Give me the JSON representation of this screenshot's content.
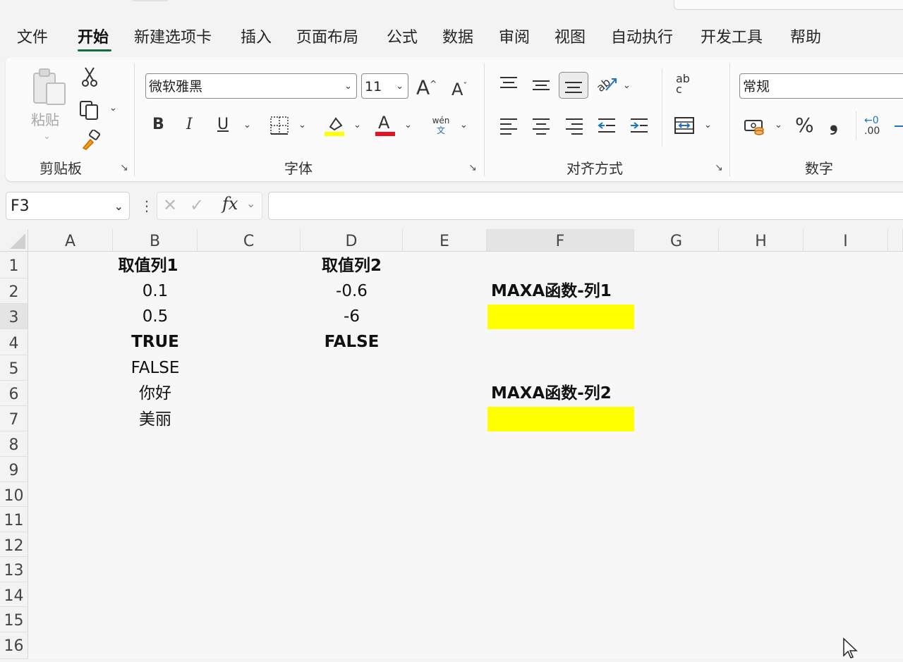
{
  "menu_tabs": [
    "文件",
    "开始",
    "新建选项卡",
    "插入",
    "页面布局",
    "公式",
    "数据",
    "审阅",
    "视图",
    "自动执行",
    "开发工具",
    "帮助"
  ],
  "active_tab": "开始",
  "ribbon": {
    "clipboard": {
      "paste_label": "粘贴",
      "group_label": "剪贴板"
    },
    "font": {
      "font_name": "微软雅黑",
      "font_size": "11",
      "bold": "B",
      "italic": "I",
      "underline": "U",
      "group_label": "字体",
      "phonetic_top": "wén",
      "phonetic_bottom": "文"
    },
    "alignment": {
      "group_label": "对齐方式",
      "wrap_ab": "ab",
      "wrap_c": "c"
    },
    "number": {
      "format": "常规",
      "group_label": "数字",
      "percent": "%",
      "comma": "❟",
      "dec_top": "←0",
      "dec_bottom": ".00"
    }
  },
  "formula_bar": {
    "name_box": "F3",
    "fx": "fx",
    "formula": ""
  },
  "columns": [
    "A",
    "B",
    "C",
    "D",
    "E",
    "F",
    "G",
    "H",
    "I"
  ],
  "rows": [
    "1",
    "2",
    "3",
    "4",
    "5",
    "6",
    "7",
    "8",
    "9",
    "10",
    "11",
    "12",
    "13",
    "14",
    "15",
    "16"
  ],
  "cells": {
    "B1": "取值列1",
    "D1": "取值列2",
    "B2": "0.1",
    "D2": "-0.6",
    "F2": "MAXA函数-列1",
    "B3": "0.5",
    "D3": "-6",
    "B4": "TRUE",
    "D4": "FALSE",
    "B5": "FALSE",
    "B6": "你好",
    "F6": "MAXA函数-列2",
    "B7": "美丽"
  },
  "colors": {
    "highlight": "#ffff00",
    "accent": "#0f6d3b",
    "font_color_bar": "#e81123",
    "fill_color_bar": "#ffff00"
  }
}
